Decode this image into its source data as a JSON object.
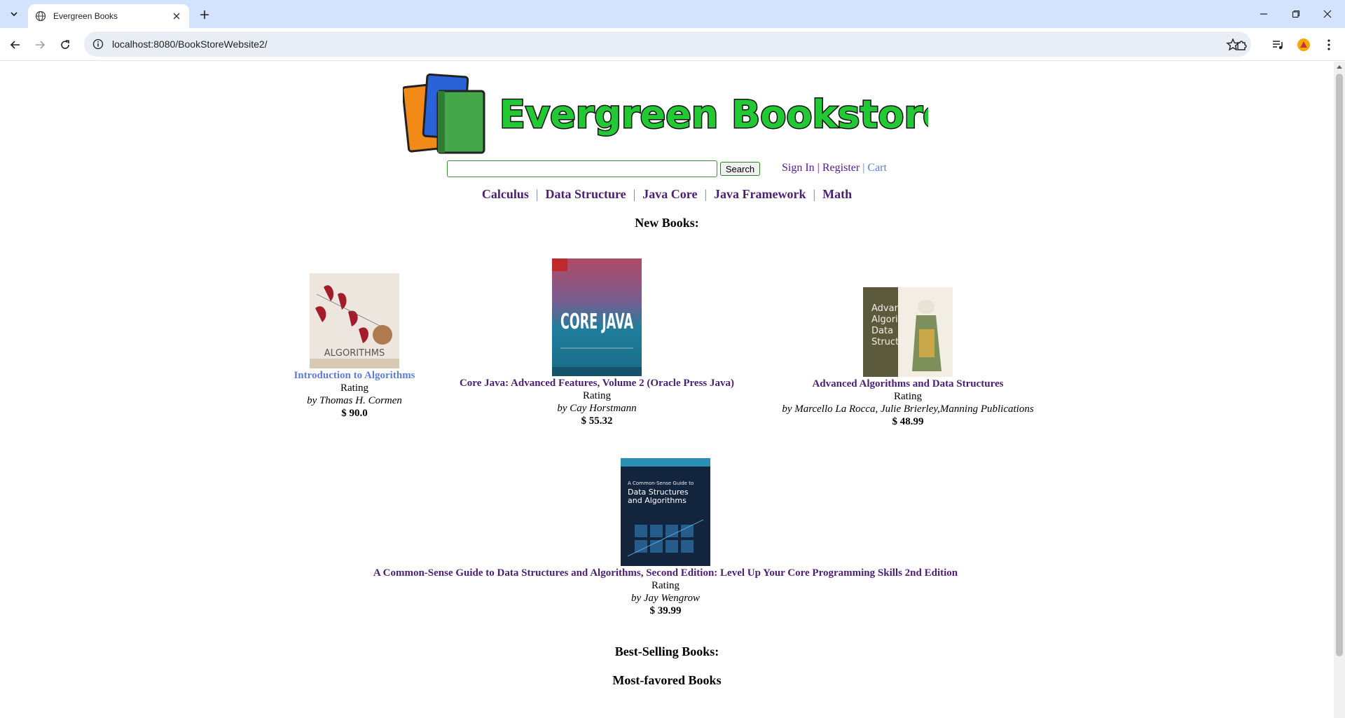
{
  "browser": {
    "tab_title": "Evergreen Books",
    "url": "localhost:8080/BookStoreWebsite2/"
  },
  "header": {
    "site_title": "Evergreen Bookstore",
    "search_button": "Search",
    "sign_in": "Sign In",
    "register": "Register",
    "cart": "Cart",
    "separator": "|"
  },
  "categories": [
    "Calculus",
    "Data Structure",
    "Java Core",
    "Java Framework",
    "Math"
  ],
  "sections": {
    "new_books": "New Books:",
    "best_selling": "Best-Selling Books:",
    "most_favored": "Most-favored Books"
  },
  "books": [
    {
      "title": "Introduction to Algorithms",
      "rating": "Rating",
      "author": "by Thomas H. Cormen",
      "price": "$ 90.0",
      "cover_text": "ALGORITHMS"
    },
    {
      "title": "Core Java: Advanced Features, Volume 2 (Oracle Press Java)",
      "rating": "Rating",
      "author": "by Cay Horstmann",
      "price": "$ 55.32",
      "cover_text": "CORE JAVA"
    },
    {
      "title": "Advanced Algorithms and Data Structures",
      "rating": "Rating",
      "author": "by Marcello La Rocca, Julie Brierley,Manning Publications",
      "price": "$ 48.99",
      "cover_text": "Advanced Algorithms and Data Structures"
    },
    {
      "title": "A Common-Sense Guide to Data Structures and Algorithms, Second Edition: Level Up Your Core Programming Skills 2nd Edition",
      "rating": "Rating",
      "author": "by Jay Wengrow",
      "price": "$ 39.99",
      "cover_text": "A Common-Sense Guide to Data Structures and Algorithms"
    }
  ],
  "colors": {
    "tabstrip": "#d3e3fd",
    "link_purple": "#4b1e74",
    "link_blue": "#5e7fd6",
    "logo_green": "#22c934"
  }
}
